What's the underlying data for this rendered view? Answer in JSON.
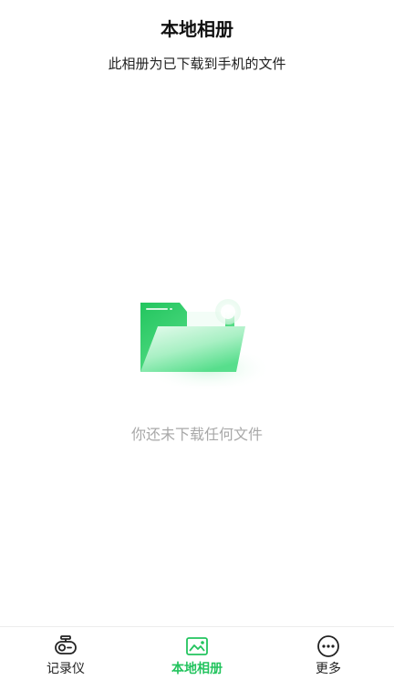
{
  "header": {
    "title": "本地相册",
    "subtitle": "此相册为已下载到手机的文件"
  },
  "empty_state": {
    "icon": "folder-icon",
    "message": "你还未下载任何文件"
  },
  "tabbar": {
    "tabs": [
      {
        "label": "记录仪",
        "icon": "dashcam-icon",
        "active": false
      },
      {
        "label": "本地相册",
        "icon": "album-icon",
        "active": true
      },
      {
        "label": "更多",
        "icon": "more-icon",
        "active": false
      }
    ]
  },
  "colors": {
    "accent": "#23c45e",
    "empty_text": "#a8a8a8"
  }
}
